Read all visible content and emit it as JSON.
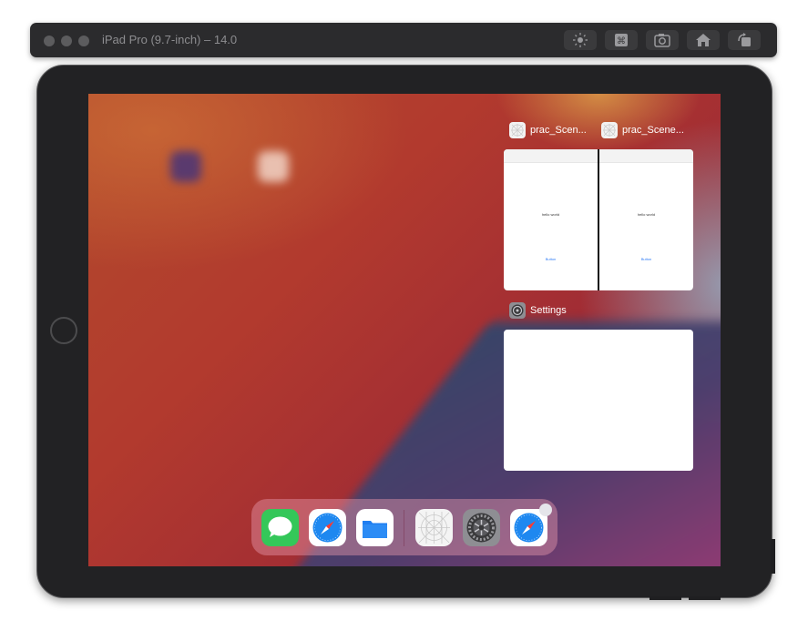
{
  "window": {
    "title": "iPad Pro (9.7-inch) – 14.0"
  },
  "toolbar_buttons": [
    {
      "name": "brightness-icon"
    },
    {
      "name": "command-icon"
    },
    {
      "name": "screenshot-icon"
    },
    {
      "name": "home-icon"
    },
    {
      "name": "rotate-icon"
    }
  ],
  "app_switcher": {
    "split_left_label": "prac_Scen...",
    "split_right_label": "prac_Scene...",
    "split_left_text": "hello world",
    "split_right_text": "hello world",
    "split_left_link": "Button",
    "split_right_link": "Button",
    "settings_label": "Settings"
  },
  "dock": {
    "apps": [
      "messages-icon",
      "safari-icon",
      "files-icon",
      "xcode-app-icon",
      "settings-icon",
      "safari-icon"
    ]
  },
  "colors": {
    "toolbar": "#2b2b2d",
    "device": "#222224",
    "messages": "#34c759",
    "files": "#1f7ef1"
  }
}
